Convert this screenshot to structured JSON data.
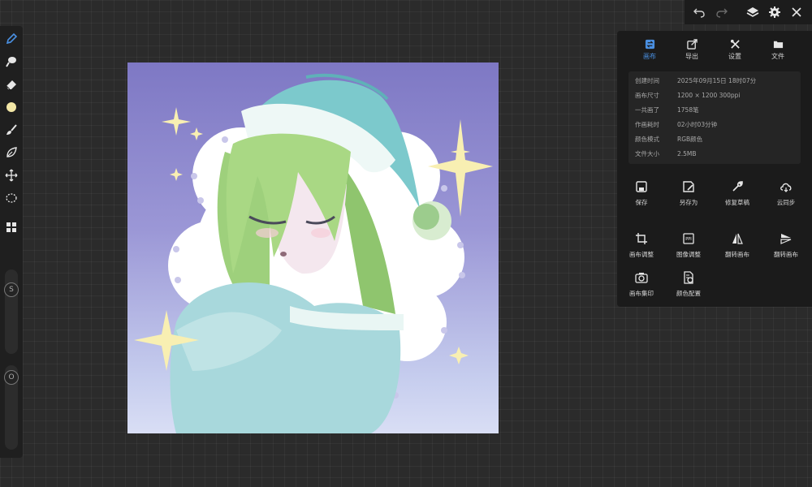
{
  "top_bar": {
    "buttons": [
      {
        "name": "undo",
        "icon": "undo-icon"
      },
      {
        "name": "redo",
        "icon": "redo-icon"
      },
      {
        "name": "layers",
        "icon": "layers-icon"
      },
      {
        "name": "settings",
        "icon": "gear-icon"
      },
      {
        "name": "close",
        "icon": "close-icon"
      }
    ]
  },
  "left_toolbar": {
    "tools": [
      {
        "name": "pen",
        "icon": "pen-icon",
        "active": true
      },
      {
        "name": "smudge",
        "icon": "smudge-icon"
      },
      {
        "name": "eraser",
        "icon": "eraser-icon"
      },
      {
        "name": "color",
        "icon": "color-swatch",
        "color": "#f3e7a6"
      },
      {
        "name": "brush",
        "icon": "brush-icon"
      },
      {
        "name": "lasso-shape",
        "icon": "leaf-icon"
      },
      {
        "name": "move",
        "icon": "move-icon"
      },
      {
        "name": "selection",
        "icon": "selection-icon"
      },
      {
        "name": "layout",
        "icon": "grid-icon"
      }
    ],
    "size_slider_label": "S",
    "opacity_slider_label": "O"
  },
  "panel": {
    "tabs": [
      {
        "label": "画布",
        "icon": "canvas-icon",
        "active": true
      },
      {
        "label": "导出",
        "icon": "export-icon",
        "active": false
      },
      {
        "label": "设置",
        "icon": "tools-icon",
        "active": false
      },
      {
        "label": "文件",
        "icon": "folder-icon",
        "active": false
      }
    ],
    "info": [
      {
        "key": "创建时间",
        "value": "2025年09月15日 18时07分"
      },
      {
        "key": "画布尺寸",
        "value": "1200 × 1200     300ppi"
      },
      {
        "key": "一共画了",
        "value": "1758笔"
      },
      {
        "key": "作画耗时",
        "value": "02小时03分钟"
      },
      {
        "key": "颜色模式",
        "value": "RGB颜色"
      },
      {
        "key": "文件大小",
        "value": "2.5MB"
      }
    ],
    "actions": [
      {
        "label": "保存",
        "icon": "save-icon"
      },
      {
        "label": "另存为",
        "icon": "save-as-icon"
      },
      {
        "label": "修复草稿",
        "icon": "wrench-icon"
      },
      {
        "label": "云同步",
        "icon": "cloud-sync-icon"
      },
      {
        "label": "画布调整",
        "icon": "crop-icon"
      },
      {
        "label": "图像调整",
        "icon": "image-adjust-icon"
      },
      {
        "label": "翻转画布",
        "icon": "flip-horizontal-icon"
      },
      {
        "label": "翻转画布",
        "icon": "flip-vertical-icon"
      },
      {
        "label": "画布集印",
        "icon": "camera-icon"
      },
      {
        "label": "颜色配置",
        "icon": "color-config-icon"
      }
    ]
  },
  "colors": {
    "accent": "#4a90e2",
    "panel_bg": "#1b1b1b",
    "workspace_bg": "#2b2b2b"
  }
}
